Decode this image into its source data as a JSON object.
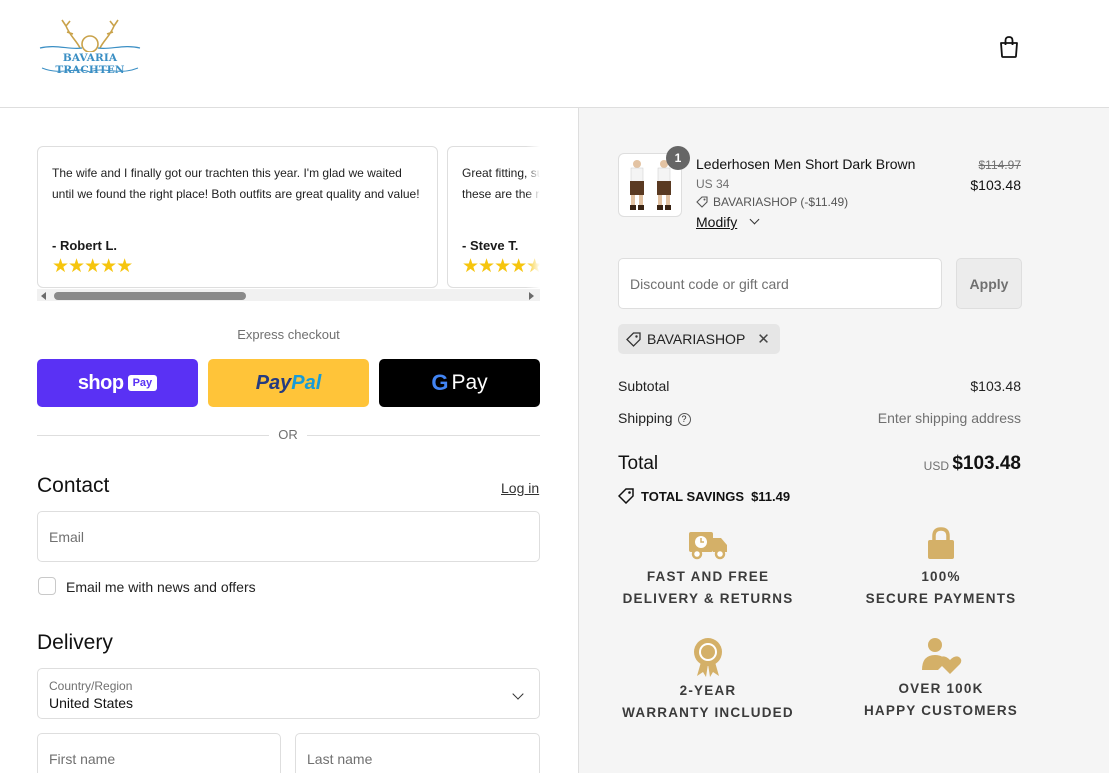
{
  "header": {
    "logo_text": "BAVARIA TRACHTEN",
    "brand_color": "#3b8fc4",
    "cart_icon": "shopping-bag-icon"
  },
  "reviews": [
    {
      "text": "The wife and I finally got our trachten this year. I'm glad we waited until we found the right place! Both outfits are great quality and value!",
      "author": "- Robert L.",
      "stars": "★★★★★"
    },
    {
      "text": "Great fitting, super quality, and the communication was fantastic, these are the real deal!",
      "author": "- Steve T.",
      "stars": "★★★★★"
    }
  ],
  "express": {
    "label": "Express checkout",
    "shop_word": "shop",
    "shop_pay": "Pay",
    "paypal_1": "Pay",
    "paypal_2": "Pal",
    "gpay_g": "G",
    "gpay_word": "Pay",
    "or": "OR"
  },
  "contact": {
    "title": "Contact",
    "login": "Log in",
    "email_placeholder": "Email",
    "newsletter_label": "Email me with news and offers"
  },
  "delivery": {
    "title": "Delivery",
    "country_label": "Country/Region",
    "country_value": "United States",
    "first_name_placeholder": "First name",
    "last_name_placeholder": "Last name"
  },
  "order": {
    "quantity": "1",
    "product_name": "Lederhosen Men Short Dark Brown",
    "variant": "US 34",
    "discount_line": "BAVARIASHOP (-$11.49)",
    "modify": "Modify",
    "old_price": "$114.97",
    "new_price": "$103.48",
    "discount_placeholder": "Discount code or gift card",
    "apply": "Apply",
    "applied_code": "BAVARIASHOP",
    "subtotal_label": "Subtotal",
    "subtotal_value": "$103.48",
    "shipping_label": "Shipping",
    "shipping_value": "Enter shipping address",
    "total_label": "Total",
    "currency": "USD",
    "total_value": "$103.48",
    "savings_label": "TOTAL SAVINGS",
    "savings_value": "$11.49"
  },
  "features": [
    {
      "icon": "delivery-truck-icon",
      "line1": "FAST AND FREE",
      "line2": "DELIVERY & RETURNS"
    },
    {
      "icon": "padlock-icon",
      "line1": "100%",
      "line2": "SECURE PAYMENTS"
    },
    {
      "icon": "award-ribbon-icon",
      "line1": "2-YEAR",
      "line2": "WARRANTY INCLUDED"
    },
    {
      "icon": "happy-customers-icon",
      "line1": "OVER 100K",
      "line2": "HAPPY CUSTOMERS"
    }
  ],
  "colors": {
    "shop_pay": "#5a31f4",
    "paypal": "#ffc439",
    "gpay": "#000000",
    "star": "#f6c50e",
    "feature_icon": "#d4b068"
  }
}
